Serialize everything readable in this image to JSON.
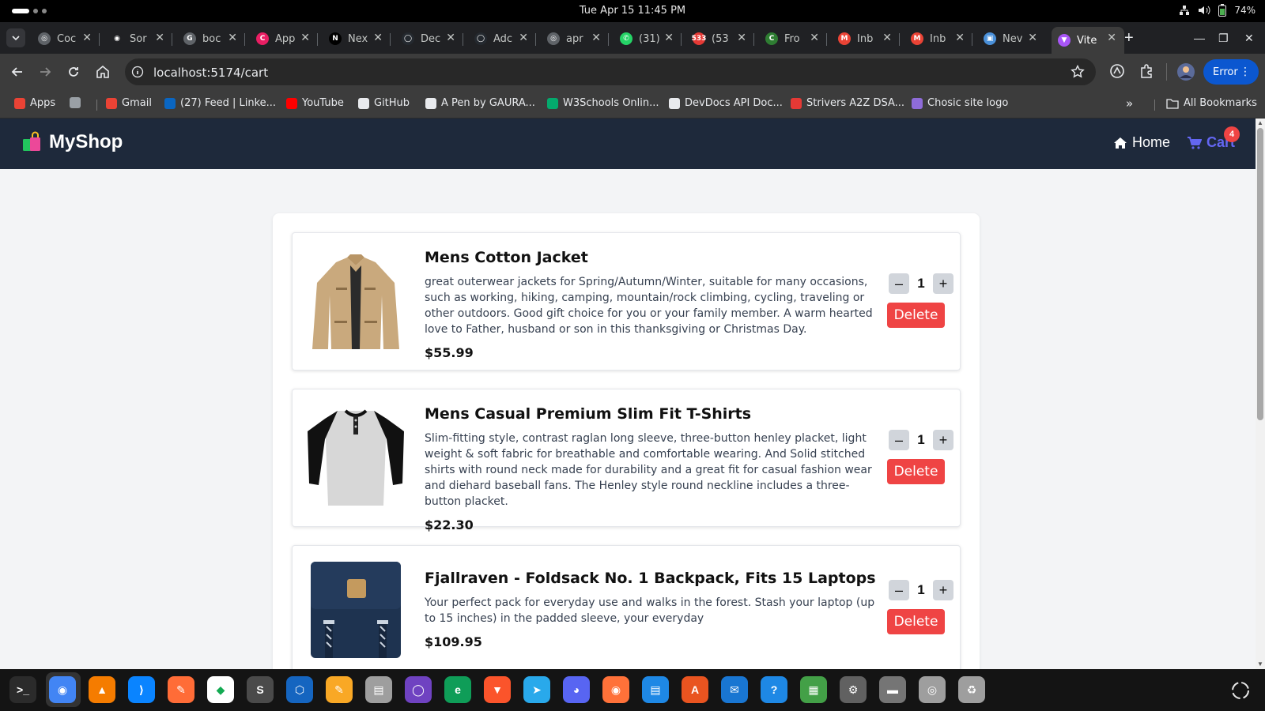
{
  "os": {
    "clock": "Tue Apr 15  11:45 PM",
    "battery": "74%"
  },
  "tabs": [
    {
      "label": "Coc",
      "color": "#5f6368",
      "glyph": "◎"
    },
    {
      "label": "Sor",
      "color": "#202124",
      "glyph": "◉"
    },
    {
      "label": "boc",
      "color": "#5f6368",
      "glyph": "G"
    },
    {
      "label": "App",
      "color": "#e91e63",
      "glyph": "C"
    },
    {
      "label": "Nex",
      "color": "#000000",
      "glyph": "N"
    },
    {
      "label": "Dec",
      "color": "#24292f",
      "glyph": "◯"
    },
    {
      "label": "Adc",
      "color": "#24292f",
      "glyph": "◯"
    },
    {
      "label": "apr",
      "color": "#5f6368",
      "glyph": "◎"
    },
    {
      "label": "(31)",
      "color": "#25d366",
      "glyph": "✆"
    },
    {
      "label": "(53",
      "color": "#e53935",
      "glyph": "533"
    },
    {
      "label": "Fro",
      "color": "#2e7d32",
      "glyph": "C"
    },
    {
      "label": "Inb",
      "color": "#ea4335",
      "glyph": "M"
    },
    {
      "label": "Inb",
      "color": "#ea4335",
      "glyph": "M"
    },
    {
      "label": "Nev",
      "color": "#4a90d9",
      "glyph": "▣"
    },
    {
      "label": "Vite",
      "color": "#a855f7",
      "glyph": "▼",
      "active": true
    }
  ],
  "toolbar": {
    "url": "localhost:5174/cart",
    "error_label": "Error"
  },
  "bookmarks": [
    {
      "label": "Apps",
      "color": "#ea4335"
    },
    {
      "label": "",
      "color": "#9aa0a6"
    },
    {
      "label": "Gmail",
      "color": "#ea4335"
    },
    {
      "label": "(27) Feed | Linke...",
      "color": "#0a66c2"
    },
    {
      "label": "YouTube",
      "color": "#ff0000"
    },
    {
      "label": "GitHub",
      "color": "#e8eaed"
    },
    {
      "label": "A Pen by GAURA...",
      "color": "#e8eaed"
    },
    {
      "label": "W3Schools Onlin...",
      "color": "#04aa6d"
    },
    {
      "label": "DevDocs API Doc...",
      "color": "#e8eaed"
    },
    {
      "label": "Strivers A2Z DSA...",
      "color": "#e53935"
    },
    {
      "label": "Chosic site logo",
      "color": "#8e6bd8"
    }
  ],
  "all_bookmarks": "All Bookmarks",
  "app": {
    "brand": "MyShop",
    "nav_home": "Home",
    "nav_cart": "Cart",
    "cart_count": "4"
  },
  "cart_items": [
    {
      "title": "Mens Cotton Jacket",
      "description": "great outerwear jackets for Spring/Autumn/Winter, suitable for many occasions, such as working, hiking, camping, mountain/rock climbing, cycling, traveling or other outdoors. Good gift choice for you or your family member. A warm hearted love to Father, husband or son in this thanksgiving or Christmas Day.",
      "price": "$55.99",
      "quantity": "1",
      "delete_label": "Delete",
      "image": "jacket"
    },
    {
      "title": "Mens Casual Premium Slim Fit T-Shirts",
      "description": "Slim-fitting style, contrast raglan long sleeve, three-button henley placket, light weight & soft fabric for breathable and comfortable wearing. And Solid stitched shirts with round neck made for durability and a great fit for casual fashion wear and diehard baseball fans. The Henley style round neckline includes a three-button placket.",
      "price": "$22.30",
      "quantity": "1",
      "delete_label": "Delete",
      "image": "tshirt"
    },
    {
      "title": "Fjallraven - Foldsack No. 1 Backpack, Fits 15 Laptops",
      "description": "Your perfect pack for everyday use and walks in the forest. Stash your laptop (up to 15 inches) in the padded sleeve, your everyday",
      "price": "$109.95",
      "quantity": "1",
      "delete_label": "Delete",
      "image": "backpack"
    }
  ],
  "dock": [
    {
      "name": "terminal",
      "color": "#2b2b2b",
      "glyph": ">_"
    },
    {
      "name": "chrome",
      "color": "#4285f4",
      "glyph": "◉"
    },
    {
      "name": "vlc",
      "color": "#f57c00",
      "glyph": "▲"
    },
    {
      "name": "vscode",
      "color": "#0a84ff",
      "glyph": "⟩"
    },
    {
      "name": "postman",
      "color": "#ff6c37",
      "glyph": "✎"
    },
    {
      "name": "mongodb-compass",
      "color": "#ffffff",
      "glyph": "◆"
    },
    {
      "name": "sublime-text",
      "color": "#4a4a4a",
      "glyph": "S"
    },
    {
      "name": "virtualbox",
      "color": "#1565c0",
      "glyph": "⬡"
    },
    {
      "name": "text-editor",
      "color": "#f9a825",
      "glyph": "✎"
    },
    {
      "name": "files",
      "color": "#9e9e9e",
      "glyph": "▤"
    },
    {
      "name": "github-desktop",
      "color": "#6f42c1",
      "glyph": "◯"
    },
    {
      "name": "edge",
      "color": "#0f9d58",
      "glyph": "e"
    },
    {
      "name": "brave",
      "color": "#fb542b",
      "glyph": "▼"
    },
    {
      "name": "telegram",
      "color": "#29a9eb",
      "glyph": "➤"
    },
    {
      "name": "discord",
      "color": "#5865f2",
      "glyph": "◕"
    },
    {
      "name": "firefox",
      "color": "#ff7139",
      "glyph": "◉"
    },
    {
      "name": "document-viewer",
      "color": "#1e88e5",
      "glyph": "▤"
    },
    {
      "name": "app-center",
      "color": "#e95420",
      "glyph": "A"
    },
    {
      "name": "thunderbird",
      "color": "#1976d2",
      "glyph": "✉"
    },
    {
      "name": "help",
      "color": "#1e88e5",
      "glyph": "?"
    },
    {
      "name": "spreadsheet",
      "color": "#43a047",
      "glyph": "▦"
    },
    {
      "name": "settings",
      "color": "#616161",
      "glyph": "⚙"
    },
    {
      "name": "disk-utility",
      "color": "#757575",
      "glyph": "▬"
    },
    {
      "name": "disks",
      "color": "#9e9e9e",
      "glyph": "◎"
    },
    {
      "name": "trash",
      "color": "#9e9e9e",
      "glyph": "♻"
    }
  ]
}
